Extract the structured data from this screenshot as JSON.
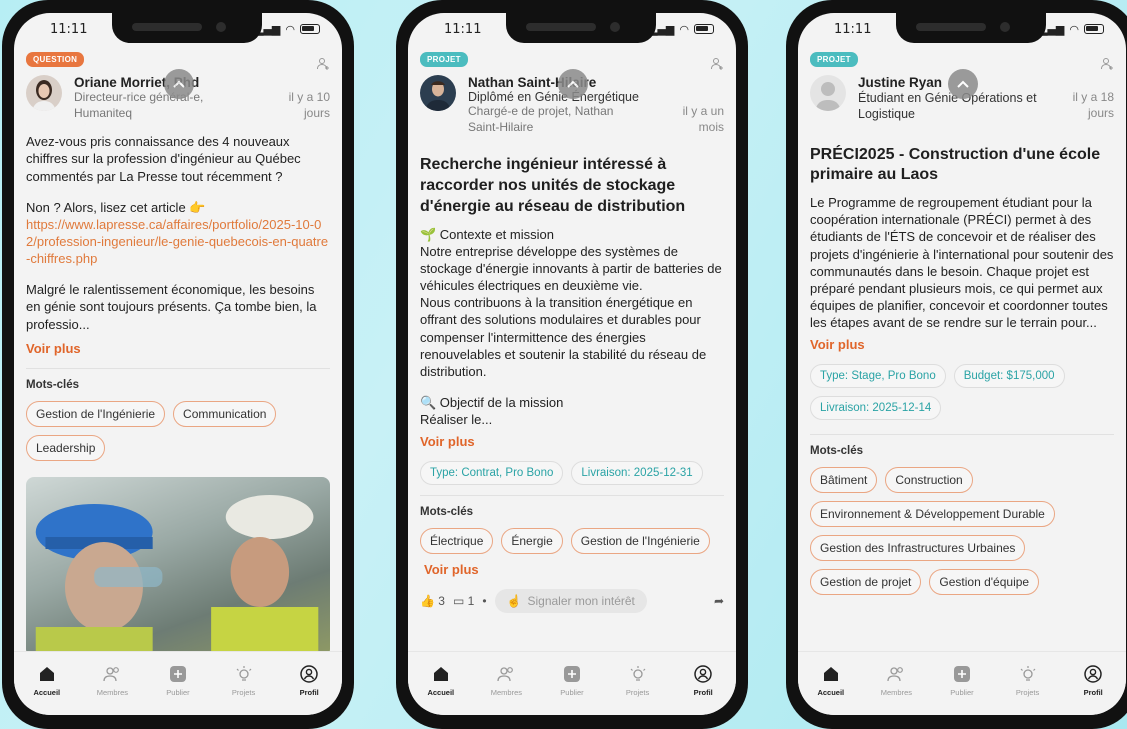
{
  "status": {
    "time": "11:11"
  },
  "nav": {
    "items": [
      {
        "label": "Accueil",
        "icon": "home-icon"
      },
      {
        "label": "Membres",
        "icon": "members-icon"
      },
      {
        "label": "Publier",
        "icon": "plus-icon"
      },
      {
        "label": "Projets",
        "icon": "lightbulb-icon"
      },
      {
        "label": "Profil",
        "icon": "profile-icon"
      }
    ]
  },
  "posts": [
    {
      "badge": "QUESTION",
      "author_name": "Oriane Morriet, Phd",
      "author_role": "Directeur-rice général-e, Humaniteq",
      "time": "il y a 10 jours",
      "body_1": "Avez-vous pris connaissance des 4 nouveaux chiffres sur la profession d'ingénieur au Québec commentés par La Presse tout récemment ?",
      "body_2_prefix": "Non ? Alors, lisez cet article 👉",
      "body_2_link": "https://www.lapresse.ca/affaires/portfolio/2025-10-02/profession-ingenieur/le-genie-quebecois-en-quatre-chiffres.php",
      "body_3": "Malgré le ralentissement économique, les besoins en génie sont toujours présents. Ça tombe bien, la professio...",
      "voir_plus": "Voir plus",
      "keywords_label": "Mots-clés",
      "keywords": [
        "Gestion de l'Ingénierie",
        "Communication",
        "Leadership"
      ]
    },
    {
      "badge": "PROJET",
      "author_name": "Nathan Saint-Hilaire",
      "author_sub": "Diplômé en Génie Énergétique",
      "author_role": "Chargé-e de projet, Nathan Saint-Hilaire",
      "time": "il y a un mois",
      "title": "Recherche ingénieur intéressé à raccorder nos unités de stockage d'énergie au réseau de distribution",
      "body_1": "🌱 Contexte et mission",
      "body_2": "Notre entreprise développe des systèmes de stockage d'énergie innovants à partir de batteries de véhicules électriques en deuxième vie.",
      "body_3": "Nous contribuons à la transition énergétique en offrant des solutions modulaires et durables pour compenser l'intermittence des énergies renouvelables et soutenir la stabilité du réseau de distribution.",
      "body_4": "🔍 Objectif de la mission",
      "body_5": "Réaliser le...",
      "voir_plus": "Voir plus",
      "meta": [
        "Type: Contrat, Pro Bono",
        "Livraison: 2025-12-31"
      ],
      "keywords_label": "Mots-clés",
      "keywords": [
        "Électrique",
        "Énergie",
        "Gestion de l'Ingénierie"
      ],
      "keywords_more": "Voir plus",
      "likes": "3",
      "comments": "1",
      "interest_label": "Signaler mon intérêt"
    },
    {
      "badge": "PROJET",
      "author_name": "Justine Ryan",
      "author_sub": "Étudiant en Génie Opérations et Logistique",
      "time": "il y a 18 jours",
      "title": "PRÉCI2025 - Construction d'une école primaire au Laos",
      "body_1": "Le Programme de regroupement étudiant pour la coopération internationale (PRÉCI) permet à des étudiants de l'ÉTS de concevoir et de réaliser des projets d'ingénierie à l'international pour soutenir des communautés dans le besoin. Chaque projet est préparé pendant plusieurs mois, ce qui permet aux équipes de planifier, concevoir et coordonner toutes les étapes avant de se rendre sur le terrain pour...",
      "voir_plus": "Voir plus",
      "meta": [
        "Type: Stage, Pro Bono",
        "Budget: $175,000",
        "Livraison: 2025-12-14"
      ],
      "keywords_label": "Mots-clés",
      "keywords": [
        "Bâtiment",
        "Construction",
        "Environnement & Développement Durable",
        "Gestion des Infrastructures Urbaines",
        "Gestion de projet",
        "Gestion d'équipe"
      ]
    }
  ],
  "colors": {
    "accent": "#e0652a",
    "teal": "#4bbcbf",
    "chip_border": "#eaa683"
  }
}
